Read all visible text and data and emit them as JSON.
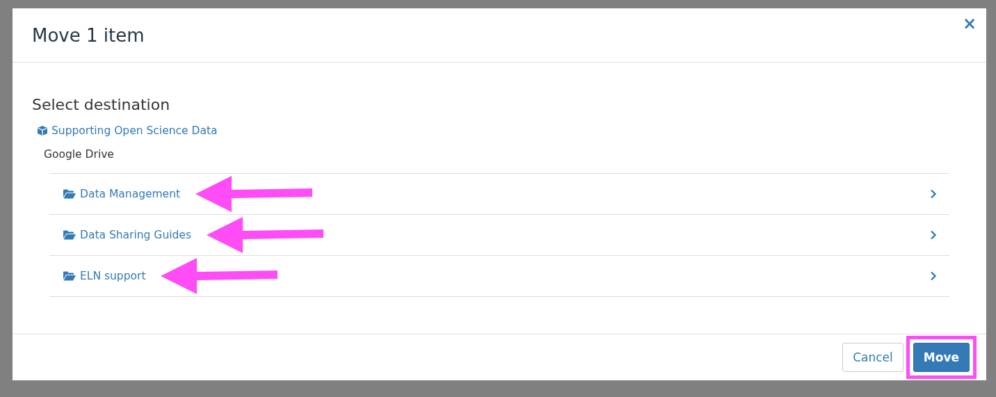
{
  "dialog": {
    "title": "Move 1 item",
    "close": "×"
  },
  "body": {
    "heading": "Select destination",
    "project": "Supporting Open Science Data",
    "provider": "Google Drive",
    "folders": [
      {
        "name": "Data Management",
        "annotated": true
      },
      {
        "name": "Data Sharing Guides",
        "annotated": true
      },
      {
        "name": "ELN support",
        "annotated": true
      }
    ]
  },
  "buttons": [
    {
      "label": "Cancel",
      "kind": "secondary",
      "highlighted": false
    },
    {
      "label": "Move",
      "kind": "primary",
      "highlighted": true
    }
  ]
}
